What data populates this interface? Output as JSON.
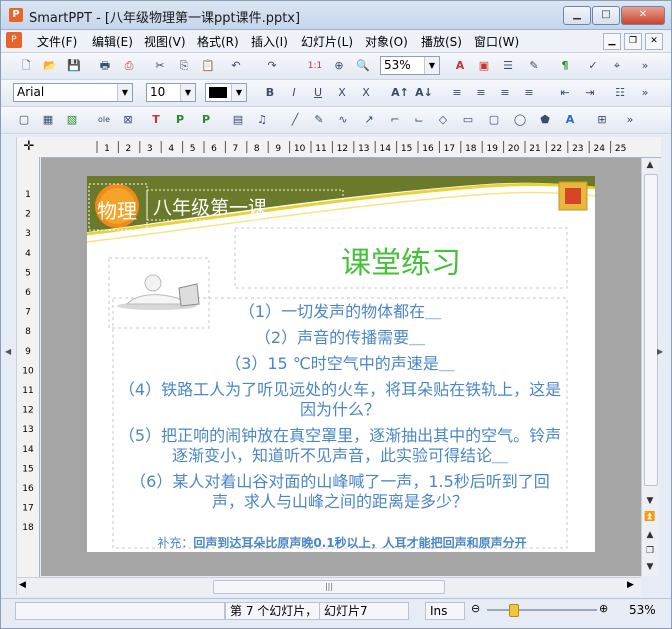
{
  "window": {
    "title": "SmartPPT - [八年级物理第一课ppt课件.pptx]",
    "app_icon": "P"
  },
  "menu": [
    "文件(F)",
    "编辑(E)",
    "视图(V)",
    "格式(R)",
    "插入(I)",
    "幻灯片(L)",
    "对象(O)",
    "播放(S)",
    "窗口(W)"
  ],
  "toolbar": {
    "zoom": "53%",
    "font_name": "Arial",
    "font_size": "10"
  },
  "ruler": {
    "h_ticks": [
      "1",
      "2",
      "3",
      "4",
      "5",
      "6",
      "7",
      "8",
      "9",
      "10",
      "11",
      "12",
      "13",
      "14",
      "15",
      "16",
      "17",
      "18",
      "19",
      "20",
      "21",
      "22",
      "23",
      "24",
      "25"
    ],
    "v_ticks": [
      "1",
      "2",
      "3",
      "4",
      "5",
      "6",
      "7",
      "8",
      "9",
      "10",
      "11",
      "12",
      "13",
      "14",
      "15",
      "16",
      "17",
      "18"
    ]
  },
  "slide": {
    "badge": "物理",
    "header": "八年级第一课",
    "title": "课堂练习",
    "questions": [
      "（1）一切发声的物体都在＿",
      "（2）声音的传播需要＿",
      "（3）15 ℃时空气中的声速是＿",
      "（4）铁路工人为了听见远处的火车，将耳朵贴在铁轨上，这是因为什么？",
      "（5）把正响的闹钟放在真空罩里，逐渐抽出其中的空气。铃声逐渐变小，知道听不见声音，此实验可得结论＿",
      "（6）某人对着山谷对面的山峰喊了一声，1.5秒后听到了回声，求人与山峰之间的距离是多少？"
    ],
    "supplement_label": "补充：",
    "supplement": "回声到达耳朵比原声晚0.1秒以上，人耳才能把回声和原声分开"
  },
  "status": {
    "slide_count": "第 7 个幻灯片，",
    "slide_name": "幻灯片7",
    "mode": "Ins",
    "zoom": "53%"
  },
  "colors": {
    "accent_green": "#3a8a2a",
    "olive": "#6b7a2a",
    "question_blue": "#4a86c8",
    "title_green": "#46c23a"
  }
}
